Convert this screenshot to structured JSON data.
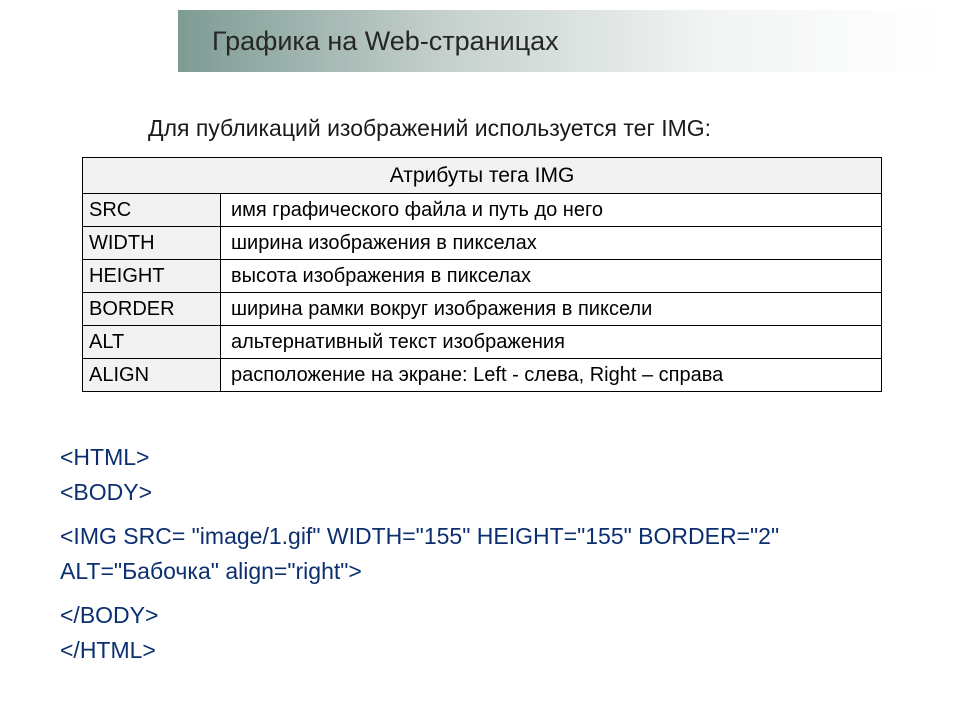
{
  "header": {
    "title": "Графика на Web-страницах"
  },
  "intro": "Для публикаций изображений используется тег IMG:",
  "table": {
    "caption": "Атрибуты тега IMG",
    "rows": [
      {
        "attr": "SRC",
        "desc": "имя графического файла и путь до него"
      },
      {
        "attr": "WIDTH",
        "desc": "ширина изображения в пикселах"
      },
      {
        "attr": "HEIGHT",
        "desc": "высота изображения в пикселах"
      },
      {
        "attr": "BORDER",
        "desc": "ширина рамки вокруг изображения в пиксели"
      },
      {
        "attr": "ALT",
        "desc": "альтернативный текст изображения"
      },
      {
        "attr": "ALIGN",
        "desc": "расположение на экране: Left - слева, Right – справа"
      }
    ]
  },
  "code": {
    "line1": "<HTML>",
    "line2": "<BODY>",
    "line3": "<IMG SRC= \"image/1.gif\" WIDTH=\"155\" HEIGHT=\"155\" BORDER=\"2\"",
    "line4": "ALT=\"Бабочка\" align=\"right\">",
    "line5": "</BODY>",
    "line6": "</HTML>"
  }
}
